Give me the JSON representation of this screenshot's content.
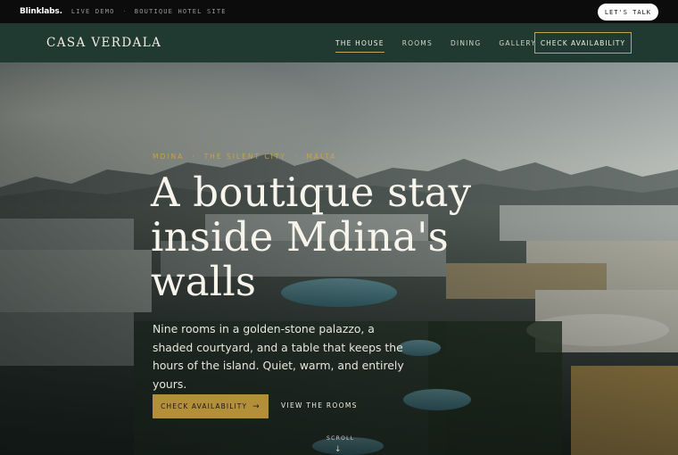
{
  "demo_bar": {
    "brand": "Blinklabs.",
    "live_demo": "LIVE DEMO",
    "separator": "·",
    "site_type": "BOUTIQUE HOTEL SITE",
    "cta": "LET'S TALK"
  },
  "nav": {
    "logo": "CASA VERDALA",
    "links": [
      {
        "label": "THE HOUSE",
        "active": true
      },
      {
        "label": "ROOMS",
        "active": false
      },
      {
        "label": "DINING",
        "active": false
      },
      {
        "label": "GALLERY",
        "active": false
      }
    ],
    "cta": "CHECK AVAILABILITY"
  },
  "hero": {
    "eyebrow": [
      "MDINA",
      "THE SILENT CITY",
      "MALTA"
    ],
    "eyebrow_separator": "·",
    "headline_lines": [
      "A boutique stay",
      "inside Mdina's",
      "walls"
    ],
    "subcopy": "Nine rooms in a golden-stone palazzo, a shaded courtyard, and a table that keeps the hours of the island. Quiet, warm, and entirely yours.",
    "primary_cta": "CHECK AVAILABILITY",
    "primary_cta_arrow": "→",
    "secondary_cta": "VIEW THE ROOMS",
    "scroll_label": "SCROLL",
    "scroll_arrow": "↓",
    "background_image": "aerial view of resort town with pools and mountains"
  },
  "colors": {
    "nav_bg": "#203a31",
    "accent_gold": "#b48f3a",
    "headline_text": "#f7f4ec",
    "demo_bar_bg": "#0c0c0c"
  }
}
